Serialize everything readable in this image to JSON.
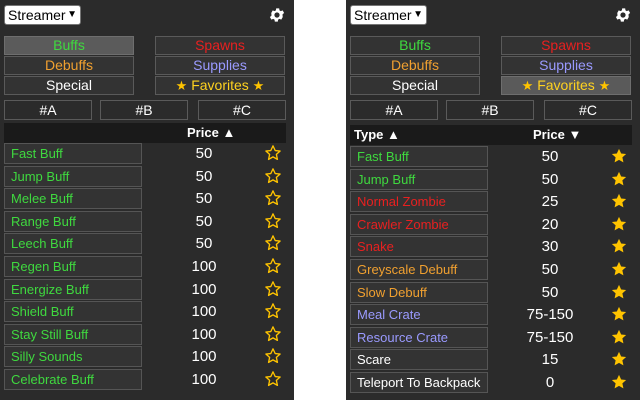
{
  "left": {
    "role_selected": "Streamer",
    "categories": {
      "buffs": "Buffs",
      "spawns": "Spawns",
      "debuffs": "Debuffs",
      "supplies": "Supplies",
      "special": "Special",
      "favorites": "Favorites"
    },
    "letters": [
      "#A",
      "#B",
      "#C"
    ],
    "header": {
      "type": "",
      "price": "Price"
    },
    "items": [
      {
        "name": "Fast Buff",
        "price": "50",
        "category": "buff",
        "favorite": false
      },
      {
        "name": "Jump Buff",
        "price": "50",
        "category": "buff",
        "favorite": false
      },
      {
        "name": "Melee Buff",
        "price": "50",
        "category": "buff",
        "favorite": false
      },
      {
        "name": "Range Buff",
        "price": "50",
        "category": "buff",
        "favorite": false
      },
      {
        "name": "Leech Buff",
        "price": "50",
        "category": "buff",
        "favorite": false
      },
      {
        "name": "Regen Buff",
        "price": "100",
        "category": "buff",
        "favorite": false
      },
      {
        "name": "Energize Buff",
        "price": "100",
        "category": "buff",
        "favorite": false
      },
      {
        "name": "Shield Buff",
        "price": "100",
        "category": "buff",
        "favorite": false
      },
      {
        "name": "Stay Still Buff",
        "price": "100",
        "category": "buff",
        "favorite": false
      },
      {
        "name": "Silly Sounds",
        "price": "100",
        "category": "buff",
        "favorite": false
      },
      {
        "name": "Celebrate Buff",
        "price": "100",
        "category": "buff",
        "favorite": false
      }
    ]
  },
  "right": {
    "role_selected": "Streamer",
    "categories": {
      "buffs": "Buffs",
      "spawns": "Spawns",
      "debuffs": "Debuffs",
      "supplies": "Supplies",
      "special": "Special",
      "favorites": "Favorites"
    },
    "letters": [
      "#A",
      "#B",
      "#C"
    ],
    "header": {
      "type": "Type",
      "price": "Price"
    },
    "items": [
      {
        "name": "Fast Buff",
        "price": "50",
        "category": "buff",
        "favorite": true
      },
      {
        "name": "Jump Buff",
        "price": "50",
        "category": "buff",
        "favorite": true
      },
      {
        "name": "Normal Zombie",
        "price": "25",
        "category": "spawn",
        "favorite": true
      },
      {
        "name": "Crawler Zombie",
        "price": "20",
        "category": "spawn",
        "favorite": true
      },
      {
        "name": "Snake",
        "price": "30",
        "category": "spawn",
        "favorite": true
      },
      {
        "name": "Greyscale Debuff",
        "price": "50",
        "category": "debuff",
        "favorite": true
      },
      {
        "name": "Slow Debuff",
        "price": "50",
        "category": "debuff",
        "favorite": true
      },
      {
        "name": "Meal Crate",
        "price": "75-150",
        "category": "supply",
        "favorite": true
      },
      {
        "name": "Resource Crate",
        "price": "75-150",
        "category": "supply",
        "favorite": true
      },
      {
        "name": "Scare",
        "price": "15",
        "category": "special",
        "favorite": true
      },
      {
        "name": "Teleport To Backpack",
        "price": "0",
        "category": "special",
        "favorite": true
      }
    ]
  },
  "colors": {
    "buff": "#3fd93f",
    "debuff": "#f0a030",
    "spawn": "#e82020",
    "supply": "#9a9aff",
    "special": "#ffffff",
    "star": "#ffc400"
  },
  "icons": {
    "settings": "gear-icon",
    "favorite": "star-icon",
    "sort_up": "caret-up-icon",
    "sort_down": "caret-down-icon"
  }
}
